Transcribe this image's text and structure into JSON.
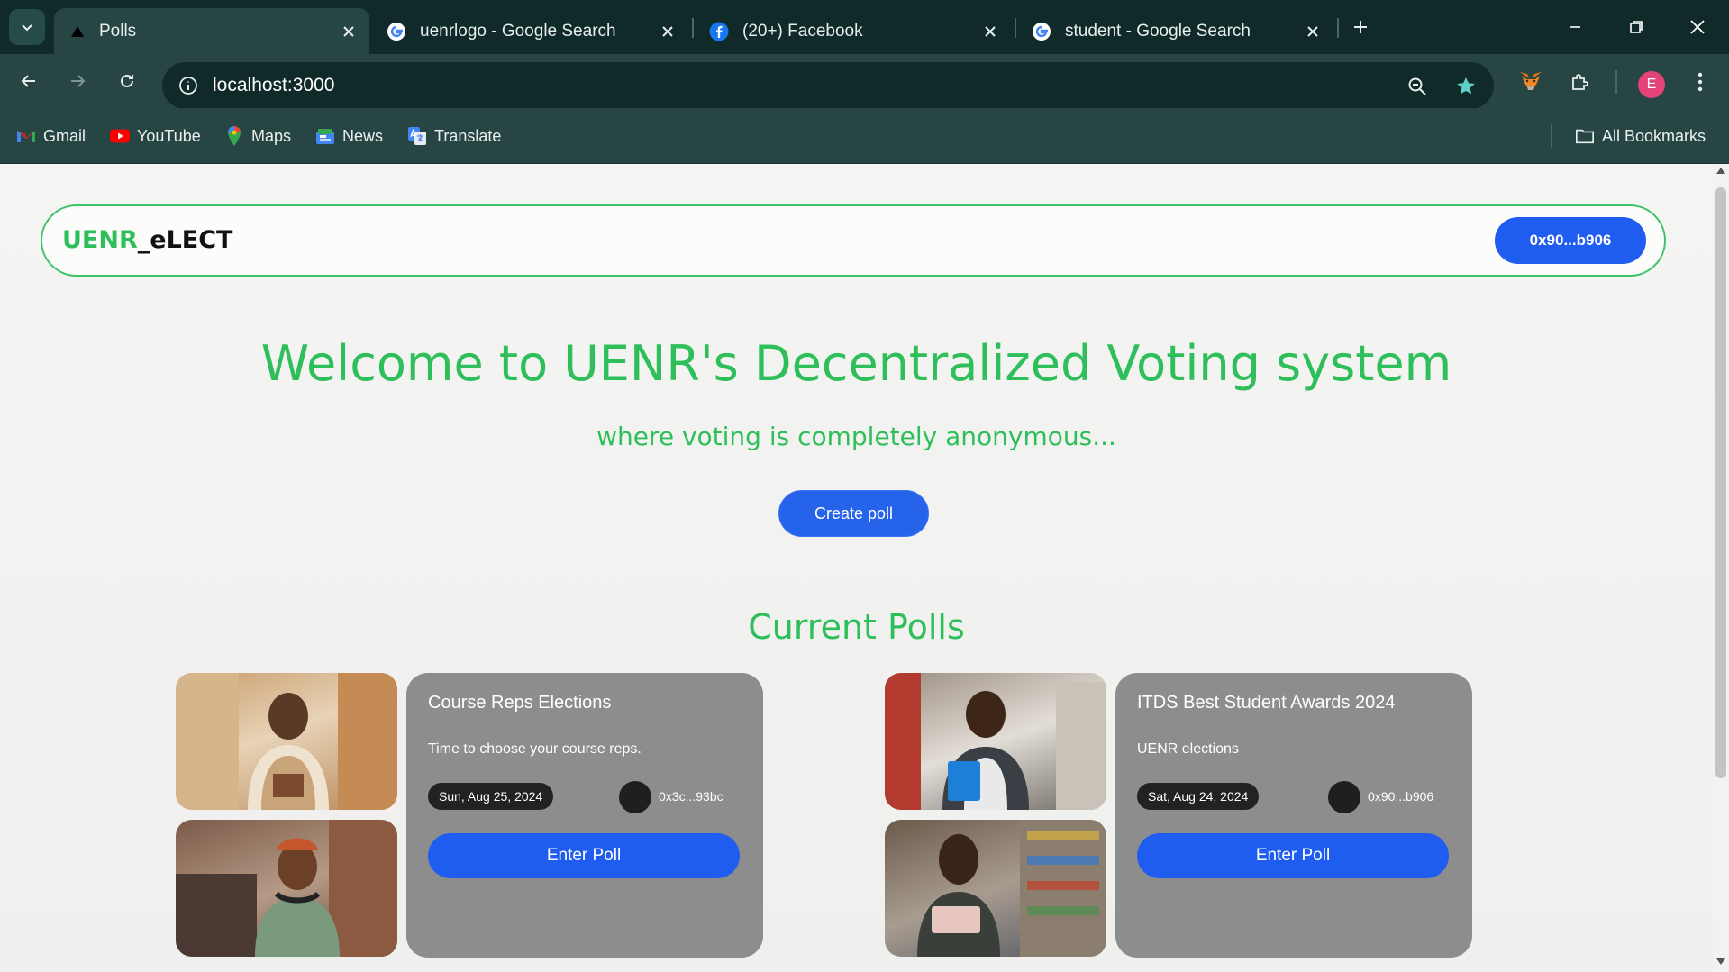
{
  "browser": {
    "tabs": [
      {
        "title": "Polls",
        "active": true,
        "favicon": "vercel-triangle-icon"
      },
      {
        "title": "uenrlogo - Google Search",
        "active": false,
        "favicon": "google-icon"
      },
      {
        "title": "(20+) Facebook",
        "active": false,
        "favicon": "facebook-icon"
      },
      {
        "title": "student - Google Search",
        "active": false,
        "favicon": "google-icon"
      }
    ],
    "url": "localhost:3000",
    "profile_initial": "E",
    "bookmarks": [
      {
        "label": "Gmail",
        "icon": "gmail-icon"
      },
      {
        "label": "YouTube",
        "icon": "youtube-icon"
      },
      {
        "label": "Maps",
        "icon": "maps-icon"
      },
      {
        "label": "News",
        "icon": "news-icon"
      },
      {
        "label": "Translate",
        "icon": "translate-icon"
      }
    ],
    "all_bookmarks": "All Bookmarks"
  },
  "app": {
    "logo_part1": "UENR",
    "logo_part2": "_eLECT",
    "wallet_address": "0x90...b906",
    "hero_title": "Welcome to UENR's Decentralized Voting system",
    "hero_subtitle": "where voting is completely anonymous...",
    "create_poll_label": "Create poll",
    "current_polls_title": "Current Polls",
    "polls": [
      {
        "title": "Course Reps Elections",
        "description": "Time to choose your course reps.",
        "date": "Sun, Aug 25, 2024",
        "owner": "0x3c...93bc",
        "enter_label": "Enter Poll"
      },
      {
        "title": "ITDS Best Student Awards 2024",
        "description": "UENR elections",
        "date": "Sat, Aug 24, 2024",
        "owner": "0x90...b906",
        "enter_label": "Enter Poll"
      }
    ]
  },
  "colors": {
    "accent_green": "#2fbf5a",
    "button_blue": "#1f5cf0",
    "card_gray": "#8d8d8d"
  }
}
